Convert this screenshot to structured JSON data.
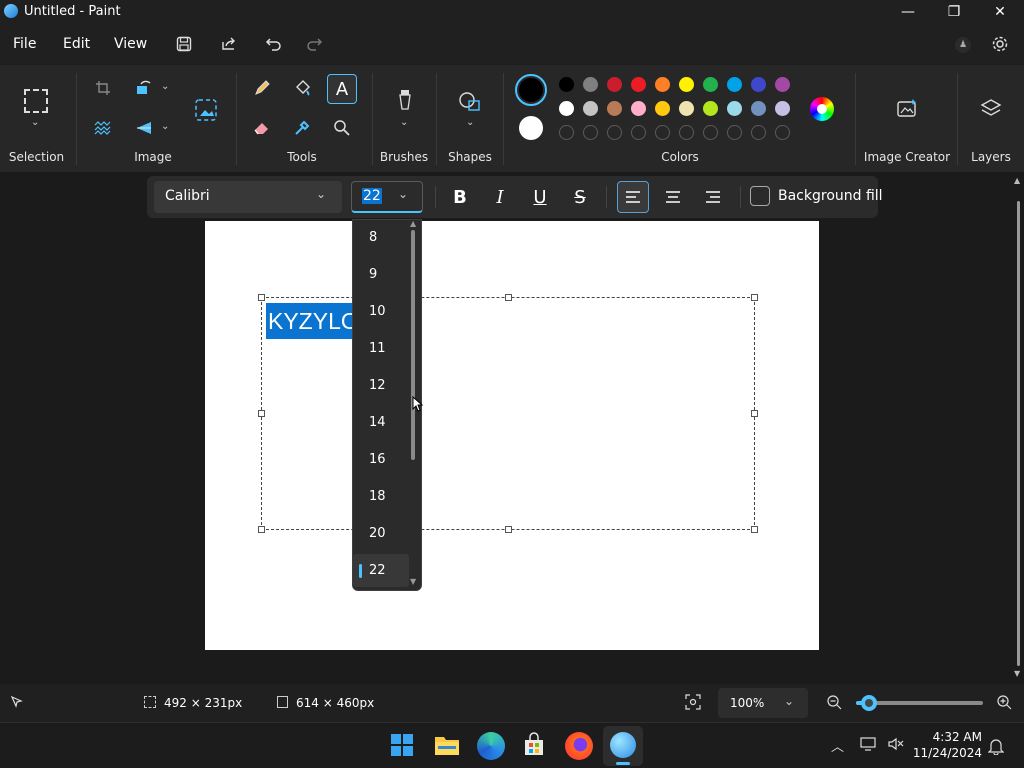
{
  "window": {
    "title": "Untitled - Paint",
    "minimize": "—",
    "maximize": "❐",
    "close": "✕"
  },
  "menu": {
    "file": "File",
    "edit": "Edit",
    "view": "View"
  },
  "ribbon": {
    "groups": {
      "selection": "Selection",
      "image": "Image",
      "tools": "Tools",
      "brushes": "Brushes",
      "shapes": "Shapes",
      "colors": "Colors",
      "image_creator": "Image Creator",
      "layers": "Layers"
    },
    "tool_text_glyph": "A",
    "colors": {
      "primary": "#000000",
      "secondary": "#ffffff",
      "row1": [
        "#000000",
        "#7f7f7f",
        "#c81e2d",
        "#ec1c24",
        "#ff7f27",
        "#fff200",
        "#22b14c",
        "#00a2e8",
        "#3f48cc",
        "#a349a4"
      ],
      "row2": [
        "#ffffff",
        "#c3c3c3",
        "#b97a57",
        "#ffaec9",
        "#ffc90e",
        "#efe4b0",
        "#b5e61d",
        "#99d9ea",
        "#7092be",
        "#c8bfe7"
      ]
    }
  },
  "text_toolbar": {
    "font": "Calibri",
    "size": "22",
    "bold": "B",
    "italic": "I",
    "underline": "U",
    "strikethrough": "S",
    "background_fill": "Background fill"
  },
  "font_size_list": {
    "items": [
      "8",
      "9",
      "10",
      "11",
      "12",
      "14",
      "16",
      "18",
      "20",
      "22"
    ],
    "selected": "22"
  },
  "canvas": {
    "text": "KYZYLO"
  },
  "status": {
    "selection_size": "492 × 231px",
    "canvas_size": "614 × 460px",
    "zoom": "100%",
    "zoom_level": 0.1
  },
  "taskbar": {
    "time": "4:32 AM",
    "date": "11/24/2024"
  }
}
